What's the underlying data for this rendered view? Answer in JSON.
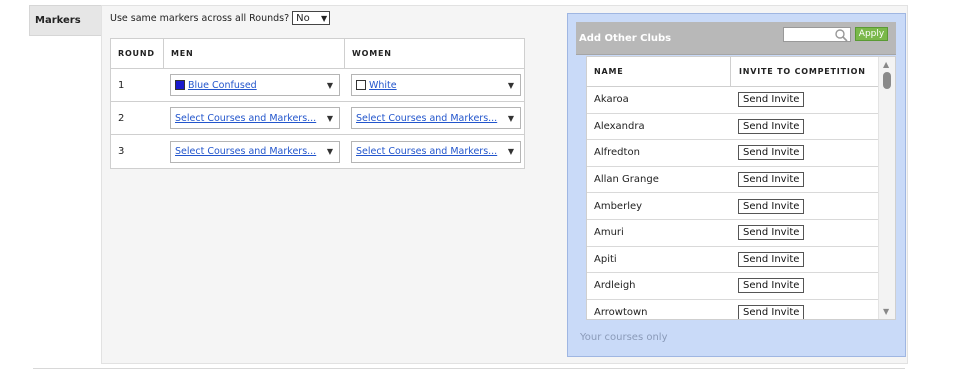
{
  "tab": {
    "label": "Markers"
  },
  "same_markers": {
    "label": "Use same markers across all Rounds?",
    "value": "No"
  },
  "rounds_table": {
    "headers": {
      "round": "ROUND",
      "men": "MEN",
      "women": "WOMEN"
    },
    "rows": [
      {
        "round": "1",
        "men": {
          "text": "Blue Confused",
          "swatch": "#1a1acc"
        },
        "women": {
          "text": "White",
          "swatch": "#ffffff"
        }
      },
      {
        "round": "2",
        "men": {
          "text": "Select Courses and Markers..."
        },
        "women": {
          "text": "Select Courses and Markers..."
        }
      },
      {
        "round": "3",
        "men": {
          "text": "Select Courses and Markers..."
        },
        "women": {
          "text": "Select Courses and Markers..."
        }
      }
    ]
  },
  "clubs": {
    "title": "Add Other Clubs",
    "search_placeholder": "",
    "apply_label": "Apply",
    "headers": {
      "name": "NAME",
      "invite": "INVITE TO COMPETITION"
    },
    "send_label": "Send Invite",
    "rows": [
      {
        "name": "Akaroa"
      },
      {
        "name": "Alexandra"
      },
      {
        "name": "Alfredton"
      },
      {
        "name": "Allan Grange"
      },
      {
        "name": "Amberley"
      },
      {
        "name": "Amuri"
      },
      {
        "name": "Apiti"
      },
      {
        "name": "Ardleigh"
      },
      {
        "name": "Arrowtown"
      }
    ],
    "footer": "Your courses only"
  },
  "colors": {
    "panel_bg": "#c9daf8",
    "link": "#2255cc",
    "apply_bg": "#7ab84a"
  }
}
